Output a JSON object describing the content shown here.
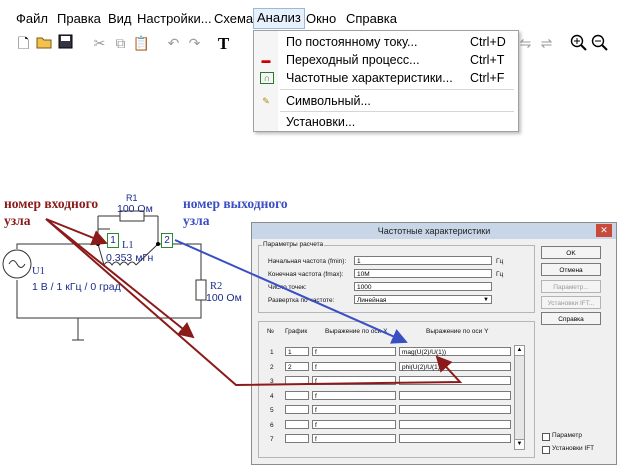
{
  "menu": {
    "items": [
      "Файл",
      "Правка",
      "Вид",
      "Настройки...",
      "Схема",
      "Анализ",
      "Окно",
      "Справка"
    ]
  },
  "toolbar": {
    "icons": [
      "new-file-icon",
      "open-folder-icon",
      "save-icon",
      "cut-icon",
      "copy-icon",
      "paste-icon",
      "undo-icon",
      "redo-icon",
      "text-icon",
      "zoom-in-icon",
      "zoom-out-icon"
    ]
  },
  "analysis_menu": {
    "items": [
      {
        "label": "По постоянному току...",
        "shortcut": "Ctrl+D"
      },
      {
        "label": "Переходный процесс...",
        "shortcut": "Ctrl+T"
      },
      {
        "label": "Частотные характеристики...",
        "shortcut": "Ctrl+F"
      },
      {
        "label": "Символьный...",
        "shortcut": ""
      },
      {
        "label": "Установки...",
        "shortcut": ""
      }
    ]
  },
  "annotations": {
    "input_node": "номер входного узла",
    "output_node": "номер выходного узла",
    "colors": {
      "input": "#8b1a1a",
      "output": "#3a4fc4"
    }
  },
  "circuit": {
    "r1_name": "R1",
    "r1_value": "100 Ом",
    "l1_name": "L1",
    "l1_value": "0.353 мГн",
    "r2_name": "R2",
    "r2_value": "100 Ом",
    "u1_name": "U1",
    "u1_value": "1 В / 1 кГц / 0 град",
    "node_in": "1",
    "node_out": "2"
  },
  "dialog": {
    "title": "Частотные характеристики",
    "params_group": "Параметры расчета",
    "fmin_label": "Начальная частота (fmin):",
    "fmin_value": "1",
    "fmin_unit": "Гц",
    "fmax_label": "Конечная частота (fmax):",
    "fmax_value": "10M",
    "fmax_unit": "Гц",
    "points_label": "Число точек:",
    "points_value": "1000",
    "sweep_label": "Развертка по частоте:",
    "sweep_value": "Линейная",
    "table_headers": [
      "№",
      "График",
      "Выражение по оси X",
      "Выражение по оси Y"
    ],
    "rows": [
      {
        "n": "1",
        "graph": "1",
        "x": "f",
        "y": "mag(U(2)/U(1))"
      },
      {
        "n": "2",
        "graph": "2",
        "x": "f",
        "y": "phi(U(2)/U(1))"
      },
      {
        "n": "3",
        "graph": "",
        "x": "f",
        "y": ""
      },
      {
        "n": "4",
        "graph": "",
        "x": "f",
        "y": ""
      },
      {
        "n": "5",
        "graph": "",
        "x": "f",
        "y": ""
      },
      {
        "n": "6",
        "graph": "",
        "x": "f",
        "y": ""
      },
      {
        "n": "7",
        "graph": "",
        "x": "f",
        "y": ""
      }
    ],
    "buttons": {
      "ok": "OK",
      "cancel": "Отмена",
      "param": "Параметр...",
      "ift": "Установки IFT...",
      "help": "Справка"
    },
    "checkboxes": {
      "param": "Параметр",
      "ift": "Установки IFT"
    }
  }
}
